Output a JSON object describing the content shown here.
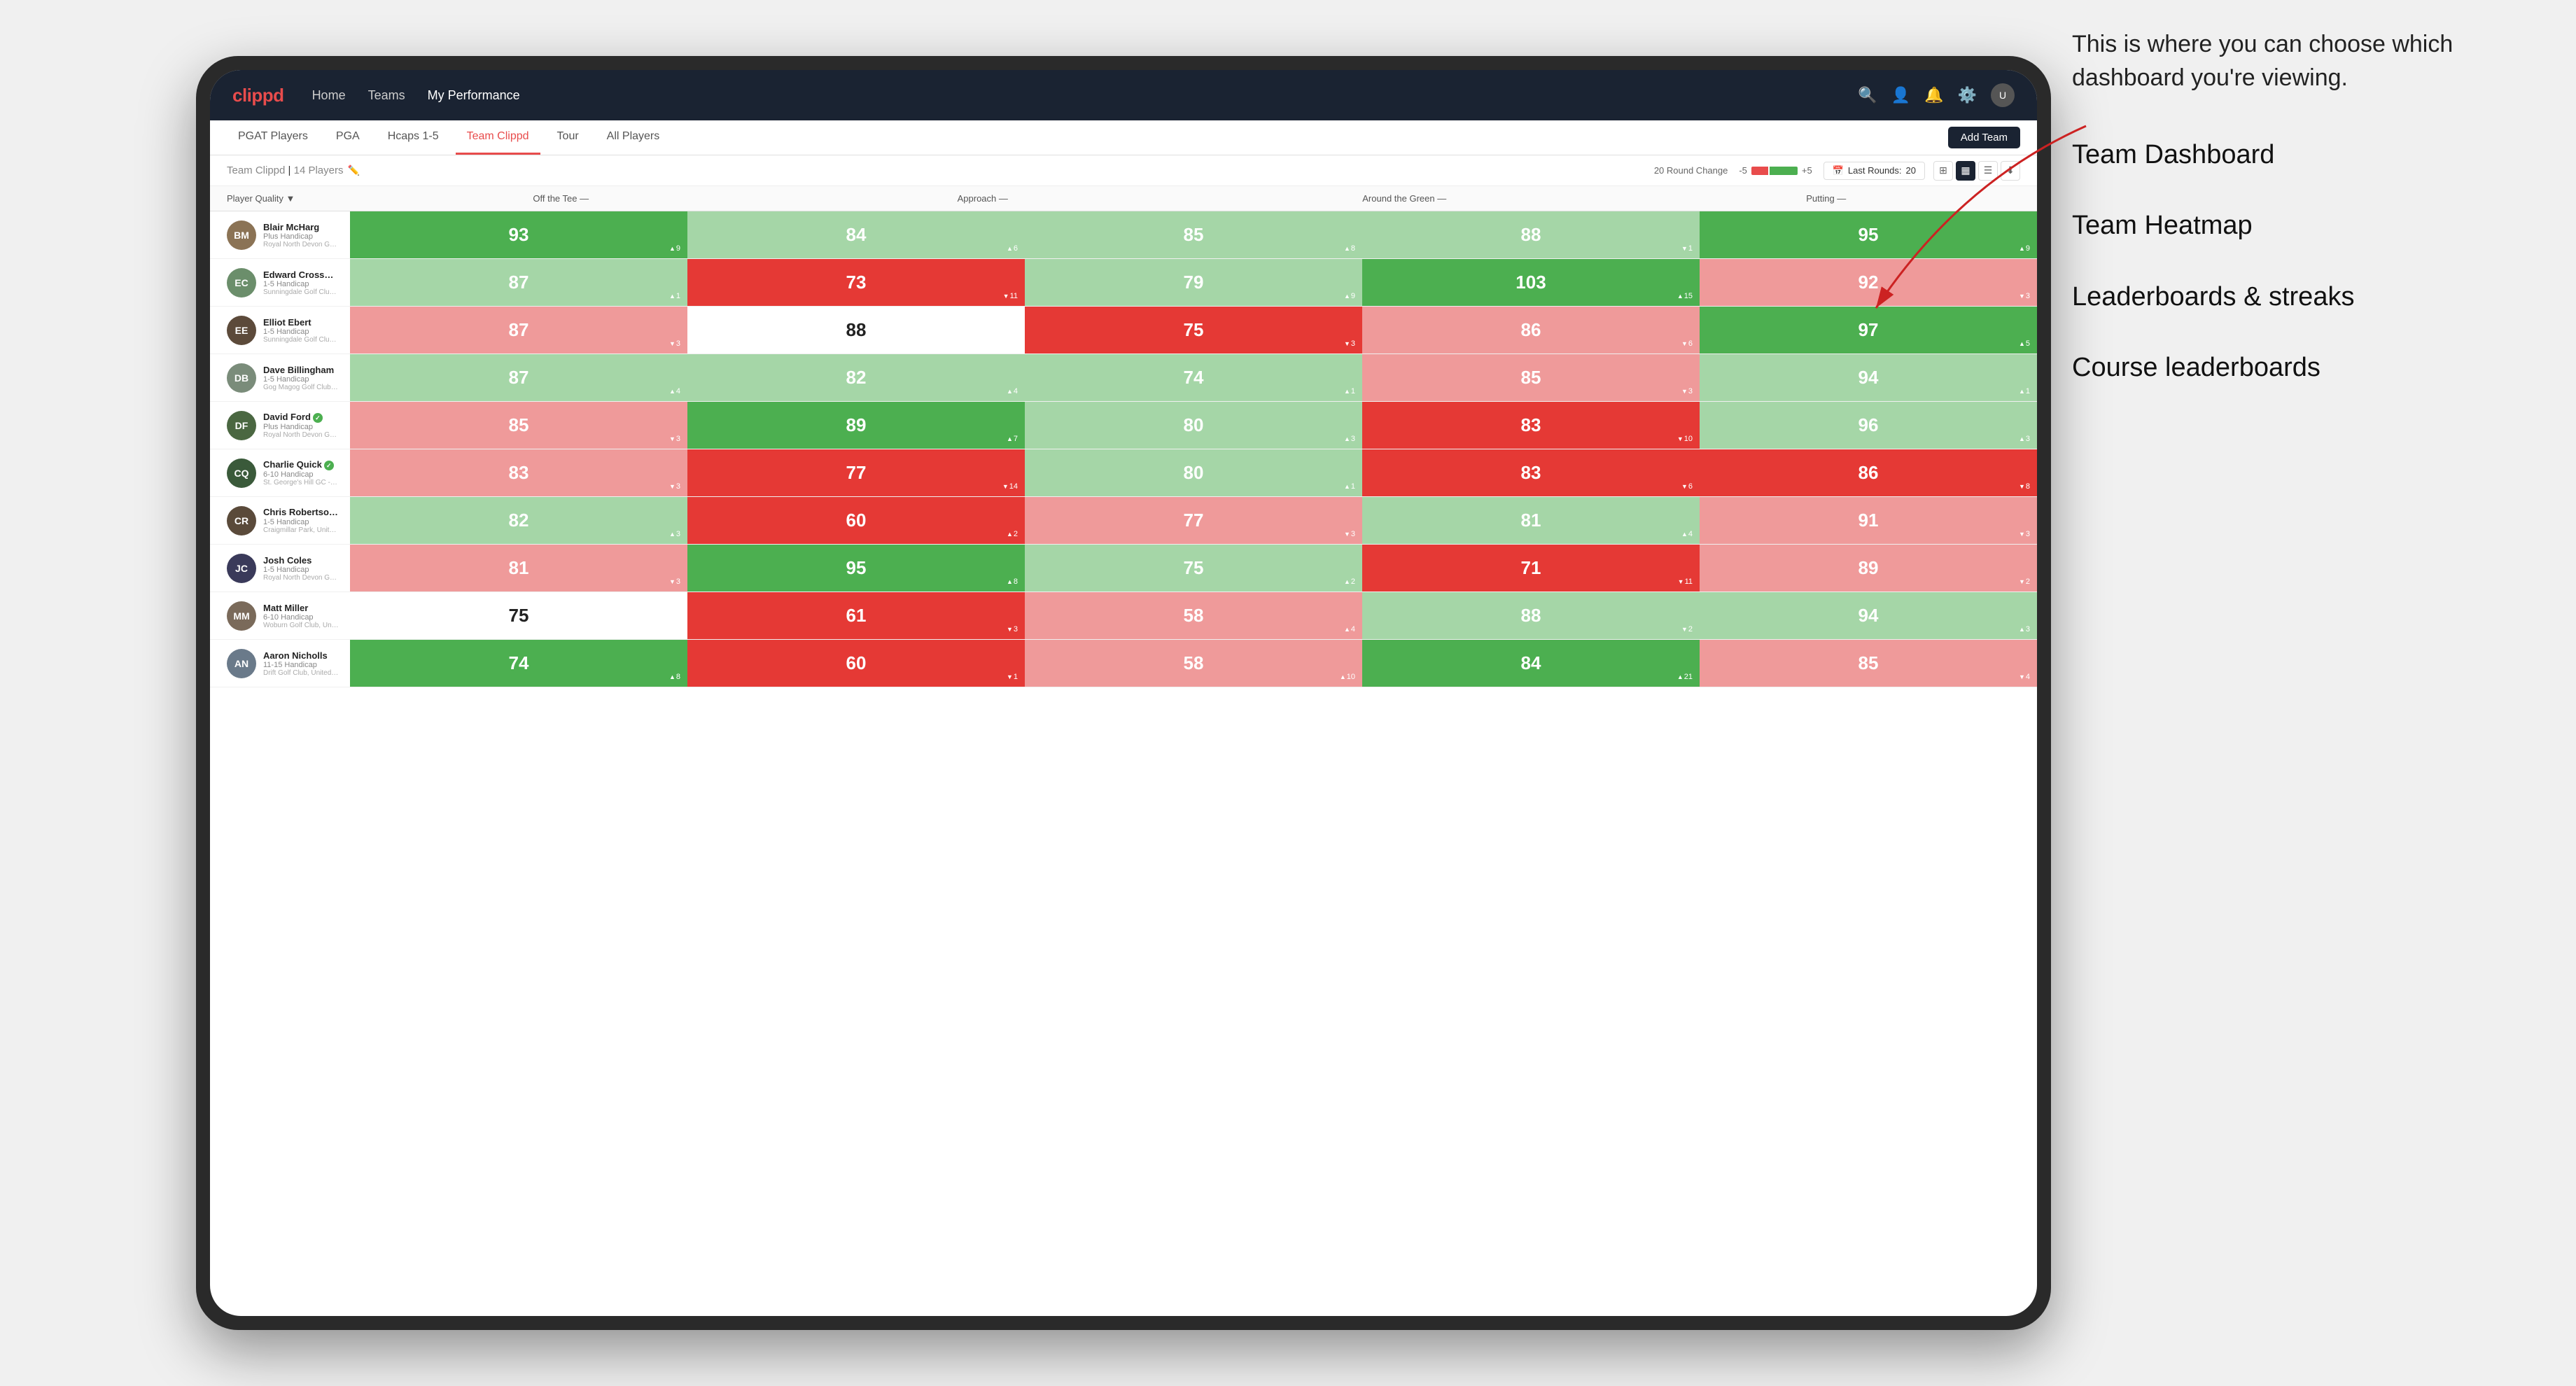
{
  "annotation": {
    "intro": "This is where you can choose which dashboard you're viewing.",
    "items": [
      "Team Dashboard",
      "Team Heatmap",
      "Leaderboards & streaks",
      "Course leaderboards"
    ]
  },
  "nav": {
    "logo": "clippd",
    "links": [
      "Home",
      "Teams",
      "My Performance"
    ],
    "icons": [
      "search",
      "person",
      "bell",
      "settings",
      "avatar"
    ]
  },
  "sub_tabs": {
    "tabs": [
      "PGAT Players",
      "PGA",
      "Hcaps 1-5",
      "Team Clippd",
      "Tour",
      "All Players"
    ],
    "active": "Team Clippd",
    "add_button": "Add Team"
  },
  "team_header": {
    "title": "Team Clippd",
    "player_count": "14 Players",
    "round_change_label": "20 Round Change",
    "neg_label": "-5",
    "pos_label": "+5",
    "last_rounds_label": "Last Rounds:",
    "last_rounds_value": "20"
  },
  "table": {
    "col_headers": {
      "player": "Player Quality ▼",
      "off_tee": "Off the Tee —",
      "approach": "Approach —",
      "around_green": "Around the Green —",
      "putting": "Putting —"
    },
    "rows": [
      {
        "name": "Blair McHarg",
        "hcap": "Plus Handicap",
        "club": "Royal North Devon Golf Club, United Kingdom",
        "initials": "BM",
        "avatar_color": "#8B7355",
        "scores": {
          "quality": {
            "value": "93",
            "change": "9▲",
            "color": "green"
          },
          "off_tee": {
            "value": "84",
            "change": "6▲",
            "color": "light-green"
          },
          "approach": {
            "value": "85",
            "change": "8▲",
            "color": "light-green"
          },
          "around_green": {
            "value": "88",
            "change": "1▼",
            "color": "light-green"
          },
          "putting": {
            "value": "95",
            "change": "9▲",
            "color": "green"
          }
        }
      },
      {
        "name": "Edward Crossman",
        "hcap": "1-5 Handicap",
        "club": "Sunningdale Golf Club, United Kingdom",
        "initials": "EC",
        "avatar_color": "#6B8E6B",
        "scores": {
          "quality": {
            "value": "87",
            "change": "1▲",
            "color": "light-green"
          },
          "off_tee": {
            "value": "73",
            "change": "11▼",
            "color": "red"
          },
          "approach": {
            "value": "79",
            "change": "9▲",
            "color": "light-green"
          },
          "around_green": {
            "value": "103",
            "change": "15▲",
            "color": "green"
          },
          "putting": {
            "value": "92",
            "change": "3▼",
            "color": "light-red"
          }
        }
      },
      {
        "name": "Elliot Ebert",
        "hcap": "1-5 Handicap",
        "club": "Sunningdale Golf Club, United Kingdom",
        "initials": "EE",
        "avatar_color": "#5C4A3A",
        "scores": {
          "quality": {
            "value": "87",
            "change": "3▼",
            "color": "light-red"
          },
          "off_tee": {
            "value": "88",
            "change": "",
            "color": "white"
          },
          "approach": {
            "value": "75",
            "change": "3▼",
            "color": "red"
          },
          "around_green": {
            "value": "86",
            "change": "6▼",
            "color": "light-red"
          },
          "putting": {
            "value": "97",
            "change": "5▲",
            "color": "green"
          }
        }
      },
      {
        "name": "Dave Billingham",
        "hcap": "1-5 Handicap",
        "club": "Gog Magog Golf Club, United Kingdom",
        "initials": "DB",
        "avatar_color": "#7A8C7A",
        "scores": {
          "quality": {
            "value": "87",
            "change": "4▲",
            "color": "light-green"
          },
          "off_tee": {
            "value": "82",
            "change": "4▲",
            "color": "light-green"
          },
          "approach": {
            "value": "74",
            "change": "1▲",
            "color": "light-green"
          },
          "around_green": {
            "value": "85",
            "change": "3▼",
            "color": "light-red"
          },
          "putting": {
            "value": "94",
            "change": "1▲",
            "color": "light-green"
          }
        }
      },
      {
        "name": "David Ford",
        "hcap": "Plus Handicap",
        "club": "Royal North Devon Golf Club, United Kingdom",
        "initials": "DF",
        "avatar_color": "#4A6741",
        "verified": true,
        "scores": {
          "quality": {
            "value": "85",
            "change": "3▼",
            "color": "light-red"
          },
          "off_tee": {
            "value": "89",
            "change": "7▲",
            "color": "green"
          },
          "approach": {
            "value": "80",
            "change": "3▲",
            "color": "light-green"
          },
          "around_green": {
            "value": "83",
            "change": "10▼",
            "color": "red"
          },
          "putting": {
            "value": "96",
            "change": "3▲",
            "color": "light-green"
          }
        }
      },
      {
        "name": "Charlie Quick",
        "hcap": "6-10 Handicap",
        "club": "St. George's Hill GC - Weybridge - Surrey, Uni...",
        "initials": "CQ",
        "avatar_color": "#3A5A3A",
        "verified": true,
        "scores": {
          "quality": {
            "value": "83",
            "change": "3▼",
            "color": "light-red"
          },
          "off_tee": {
            "value": "77",
            "change": "14▼",
            "color": "red"
          },
          "approach": {
            "value": "80",
            "change": "1▲",
            "color": "light-green"
          },
          "around_green": {
            "value": "83",
            "change": "6▼",
            "color": "red"
          },
          "putting": {
            "value": "86",
            "change": "8▼",
            "color": "red"
          }
        }
      },
      {
        "name": "Chris Robertson",
        "hcap": "1-5 Handicap",
        "club": "Craigmillar Park, United Kingdom",
        "initials": "CR",
        "avatar_color": "#5A4A3A",
        "verified": true,
        "scores": {
          "quality": {
            "value": "82",
            "change": "3▲",
            "color": "light-green"
          },
          "off_tee": {
            "value": "60",
            "change": "2▲",
            "color": "red"
          },
          "approach": {
            "value": "77",
            "change": "3▼",
            "color": "light-red"
          },
          "around_green": {
            "value": "81",
            "change": "4▲",
            "color": "light-green"
          },
          "putting": {
            "value": "91",
            "change": "3▼",
            "color": "light-red"
          }
        }
      },
      {
        "name": "Josh Coles",
        "hcap": "1-5 Handicap",
        "club": "Royal North Devon Golf Club, United Kingdom",
        "initials": "JC",
        "avatar_color": "#3A3A5A",
        "scores": {
          "quality": {
            "value": "81",
            "change": "3▼",
            "color": "light-red"
          },
          "off_tee": {
            "value": "95",
            "change": "8▲",
            "color": "green"
          },
          "approach": {
            "value": "75",
            "change": "2▲",
            "color": "light-green"
          },
          "around_green": {
            "value": "71",
            "change": "11▼",
            "color": "red"
          },
          "putting": {
            "value": "89",
            "change": "2▼",
            "color": "light-red"
          }
        }
      },
      {
        "name": "Matt Miller",
        "hcap": "6-10 Handicap",
        "club": "Woburn Golf Club, United Kingdom",
        "initials": "MM",
        "avatar_color": "#7A6A5A",
        "scores": {
          "quality": {
            "value": "75",
            "change": "",
            "color": "white"
          },
          "off_tee": {
            "value": "61",
            "change": "3▼",
            "color": "red"
          },
          "approach": {
            "value": "58",
            "change": "4▲",
            "color": "light-red"
          },
          "around_green": {
            "value": "88",
            "change": "2▼",
            "color": "light-green"
          },
          "putting": {
            "value": "94",
            "change": "3▲",
            "color": "light-green"
          }
        }
      },
      {
        "name": "Aaron Nicholls",
        "hcap": "11-15 Handicap",
        "club": "Drift Golf Club, United Kingdom",
        "initials": "AN",
        "avatar_color": "#6A7A8A",
        "scores": {
          "quality": {
            "value": "74",
            "change": "8▲",
            "color": "green"
          },
          "off_tee": {
            "value": "60",
            "change": "1▼",
            "color": "red"
          },
          "approach": {
            "value": "58",
            "change": "10▲",
            "color": "light-red"
          },
          "around_green": {
            "value": "84",
            "change": "21▲",
            "color": "green"
          },
          "putting": {
            "value": "85",
            "change": "4▼",
            "color": "light-red"
          }
        }
      }
    ]
  }
}
